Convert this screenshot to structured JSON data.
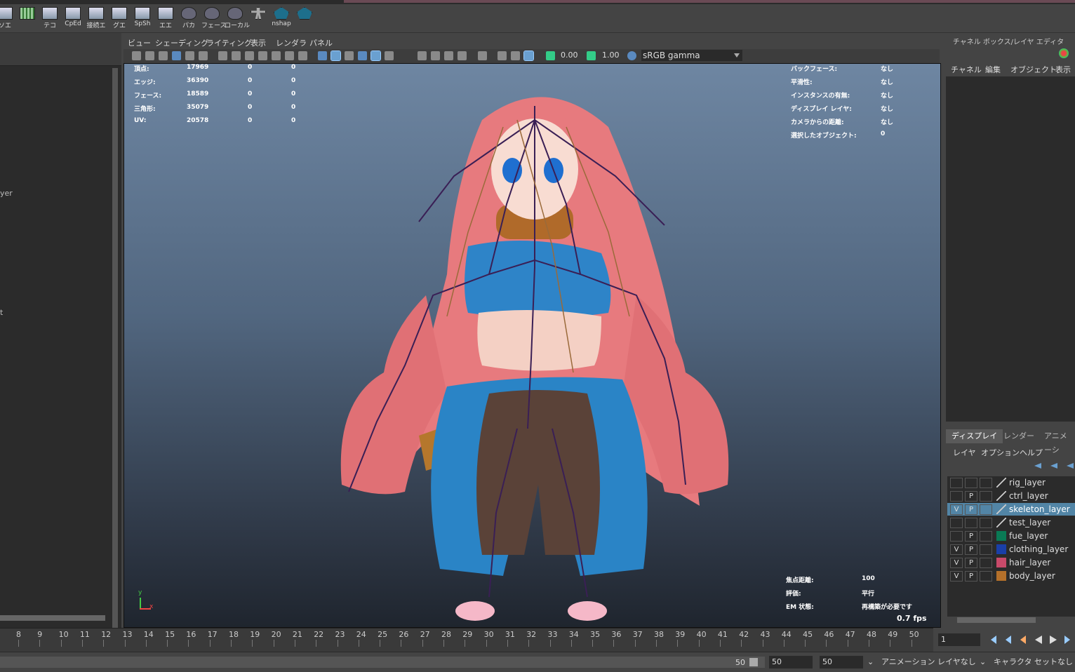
{
  "shelf": {
    "labels": [
      "ソエ",
      "",
      "テコ",
      "CpEd",
      "接続エ",
      "グエ",
      "SpSh",
      "エエ",
      "パカ",
      "フェース",
      "ローカル",
      "",
      "nshap",
      ""
    ]
  },
  "left_panel": {
    "fragments": [
      "yer",
      "t"
    ]
  },
  "viewport": {
    "menu": [
      "ビュー",
      "シェーディング",
      "ライティング",
      "表示",
      "レンダラ",
      "パネル"
    ],
    "toolbar": {
      "value_a": "0.00",
      "value_b": "1.00",
      "color_space": "sRGB gamma"
    },
    "hud_left": [
      {
        "label": "頂点:",
        "v1": "17969",
        "v2": "0",
        "v3": "0"
      },
      {
        "label": "エッジ:",
        "v1": "36390",
        "v2": "0",
        "v3": "0"
      },
      {
        "label": "フェース:",
        "v1": "18589",
        "v2": "0",
        "v3": "0"
      },
      {
        "label": "三角形:",
        "v1": "35079",
        "v2": "0",
        "v3": "0"
      },
      {
        "label": "UV:",
        "v1": "20578",
        "v2": "0",
        "v3": "0"
      }
    ],
    "hud_right": [
      {
        "label": "バックフェース:",
        "value": "なし"
      },
      {
        "label": "平滑性:",
        "value": "なし"
      },
      {
        "label": "インスタンスの有無:",
        "value": "なし"
      },
      {
        "label": "ディスプレイ レイヤ:",
        "value": "なし"
      },
      {
        "label": "カメラからの距離:",
        "value": "なし"
      },
      {
        "label": "選択したオブジェクト:",
        "value": "0"
      }
    ],
    "hud_bottom": [
      {
        "label": "焦点距離:",
        "value": "100"
      },
      {
        "label": "評価:",
        "value": "平行"
      },
      {
        "label": "EM 状態:",
        "value": "再構築が必要です"
      }
    ],
    "fps": "0.7 fps",
    "axis_y": "y",
    "axis_x": "x"
  },
  "channel_box": {
    "title": "チャネル ボックス/レイヤ エディタ",
    "menu": [
      "チャネル",
      "編集",
      "オブジェクト",
      "表示"
    ]
  },
  "layer_editor": {
    "tabs": [
      "ディスプレイ",
      "レンダー",
      "アニメーシ"
    ],
    "menu": [
      "レイヤ",
      "オプション",
      "ヘルプ"
    ],
    "layers": [
      {
        "v": "",
        "p": "",
        "name": "rig_layer",
        "color": "",
        "selected": false
      },
      {
        "v": "",
        "p": "P",
        "name": "ctrl_layer",
        "color": "",
        "selected": false
      },
      {
        "v": "V",
        "p": "P",
        "name": "skeleton_layer",
        "color": "",
        "selected": true
      },
      {
        "v": "",
        "p": "",
        "name": "test_layer",
        "color": "",
        "selected": false
      },
      {
        "v": "",
        "p": "P",
        "name": "fue_layer",
        "color": "#0a7a55",
        "selected": false
      },
      {
        "v": "V",
        "p": "P",
        "name": "clothing_layer",
        "color": "#1a3fa8",
        "selected": false
      },
      {
        "v": "V",
        "p": "P",
        "name": "hair_layer",
        "color": "#c84a6a",
        "selected": false
      },
      {
        "v": "V",
        "p": "P",
        "name": "body_layer",
        "color": "#b4702a",
        "selected": false
      }
    ]
  },
  "timeline": {
    "ticks": [
      "8",
      "9",
      "10",
      "11",
      "12",
      "13",
      "14",
      "15",
      "16",
      "17",
      "18",
      "19",
      "20",
      "21",
      "22",
      "23",
      "24",
      "25",
      "26",
      "27",
      "28",
      "29",
      "30",
      "31",
      "32",
      "33",
      "34",
      "35",
      "36",
      "37",
      "38",
      "39",
      "40",
      "41",
      "42",
      "43",
      "44",
      "45",
      "46",
      "47",
      "48",
      "49",
      "50"
    ],
    "current_frame": "1"
  },
  "range_bar": {
    "end_value": "50",
    "field_a": "50",
    "field_b": "50",
    "anim_layer": "アニメーション レイヤなし",
    "char_set": "キャラクタ セットなし"
  }
}
